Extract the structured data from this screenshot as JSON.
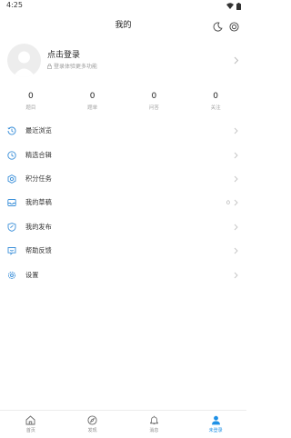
{
  "status": {
    "time": "4:25"
  },
  "header": {
    "title": "我的"
  },
  "profile": {
    "name": "点击登录",
    "hint": "登录体验更多功能"
  },
  "stats": [
    {
      "value": "0",
      "label": "题目"
    },
    {
      "value": "0",
      "label": "题单"
    },
    {
      "value": "0",
      "label": "问答"
    },
    {
      "value": "0",
      "label": "关注"
    }
  ],
  "menu": [
    {
      "label": "最近浏览",
      "count": "",
      "icon": "history-icon"
    },
    {
      "label": "精选合辑",
      "count": "",
      "icon": "collection-icon"
    },
    {
      "label": "积分任务",
      "count": "",
      "icon": "task-icon"
    },
    {
      "label": "我的草稿",
      "count": "0",
      "icon": "draft-icon"
    },
    {
      "label": "我的发布",
      "count": "",
      "icon": "publish-icon"
    },
    {
      "label": "帮助反馈",
      "count": "",
      "icon": "feedback-icon"
    },
    {
      "label": "设置",
      "count": "",
      "icon": "settings-icon"
    }
  ],
  "tabs": [
    {
      "label": "首页",
      "icon": "home-icon"
    },
    {
      "label": "发现",
      "icon": "compass-icon"
    },
    {
      "label": "消息",
      "icon": "bell-icon"
    },
    {
      "label": "未登录",
      "icon": "user-icon"
    }
  ],
  "colors": {
    "accent": "#1e90e6",
    "icon": "#3a8fd9"
  }
}
